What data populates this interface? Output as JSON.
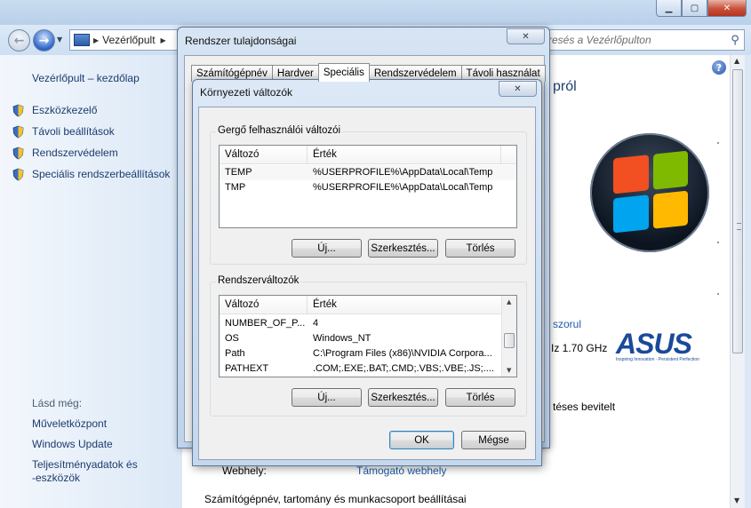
{
  "window": {
    "caption_minimize": "▁",
    "caption_maximize": "▢",
    "caption_close": "✕"
  },
  "addressbar": {
    "crumb": "Vezérlőpult",
    "search_placeholder": "resés a Vezérlőpulton"
  },
  "sidebar": {
    "home": "Vezérlőpult – kezdőlap",
    "items": [
      {
        "label": "Eszközkezelő",
        "icon": "shield-icon"
      },
      {
        "label": "Távoli beállítások",
        "icon": "shield-icon"
      },
      {
        "label": "Rendszervédelem",
        "icon": "shield-icon"
      },
      {
        "label": "Speciális rendszerbeállítások",
        "icon": "shield-icon"
      }
    ],
    "see_also_label": "Lásd még:",
    "see_also": [
      "Műveletközpont",
      "Windows Update",
      "Teljesítményadatok és",
      "-eszközök"
    ]
  },
  "content": {
    "heading_fragment": "pról",
    "rating_link": "szorul",
    "cpu_fragment": "Iz   1.70 GHz",
    "asus_logo": "ASUS",
    "asus_tagline": "Inspiring Innovation · Persistent Perfection",
    "input_fragment": "téses bevitelt",
    "website_label": "Webhely:",
    "support_link": "Támogató webhely",
    "computer_name_heading": "Számítógépnév, tartomány és munkacsoport beállításai"
  },
  "sysprop": {
    "title": "Rendszer tulajdonságai",
    "tabs": [
      "Számítógépnév",
      "Hardver",
      "Speciális",
      "Rendszervédelem",
      "Távoli használat"
    ],
    "active_tab": "Speciális"
  },
  "envvar": {
    "title": "Környezeti változók",
    "user_group": {
      "legend": "Gergő felhasználói változói",
      "columns": [
        "Változó",
        "Érték"
      ],
      "rows": [
        {
          "name": "TEMP",
          "value": "%USERPROFILE%\\AppData\\Local\\Temp"
        },
        {
          "name": "TMP",
          "value": "%USERPROFILE%\\AppData\\Local\\Temp"
        }
      ],
      "buttons": {
        "new": "Új...",
        "edit": "Szerkesztés...",
        "delete": "Törlés"
      }
    },
    "system_group": {
      "legend": "Rendszerváltozók",
      "columns": [
        "Változó",
        "Érték"
      ],
      "rows": [
        {
          "name": "NUMBER_OF_P...",
          "value": "4"
        },
        {
          "name": "OS",
          "value": "Windows_NT"
        },
        {
          "name": "Path",
          "value": "C:\\Program Files (x86)\\NVIDIA Corpora..."
        },
        {
          "name": "PATHEXT",
          "value": ".COM;.EXE;.BAT;.CMD;.VBS;.VBE;.JS;...."
        }
      ],
      "buttons": {
        "new": "Új...",
        "edit": "Szerkesztés...",
        "delete": "Törlés"
      }
    },
    "ok": "OK",
    "cancel": "Mégse"
  },
  "colors": {
    "link": "#1d3b6e",
    "windows_flag": [
      "#f25022",
      "#7fba00",
      "#00a4ef",
      "#ffb900"
    ]
  }
}
